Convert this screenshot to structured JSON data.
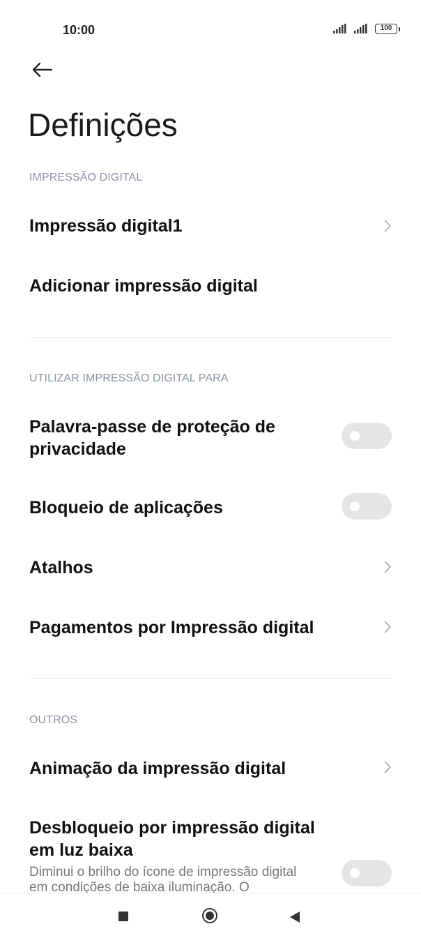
{
  "status": {
    "time": "10:00",
    "battery": "100"
  },
  "title": "Definições",
  "sections": {
    "fingerprint": "IMPRESSÃO DIGITAL",
    "use_for": "UTILIZAR IMPRESSÃO DIGITAL PARA",
    "others": "OUTROS"
  },
  "items": {
    "fingerprint1": "Impressão digital1",
    "add_fingerprint": "Adicionar impressão digital",
    "privacy_password": "Palavra-passe de proteção de privacidade",
    "app_lock": "Bloqueio de aplicações",
    "shortcuts": "Atalhos",
    "payments": "Pagamentos por Impressão digital",
    "animation": "Animação da impressão digital",
    "low_light_unlock": "Desbloqueio por impressão digital em luz baixa",
    "low_light_desc": "Diminui o brilho do ícone de impressão digital em condições de baixa iluminação. O"
  },
  "toggles": {
    "privacy_password": false,
    "app_lock": false,
    "low_light_unlock": false
  },
  "icons": [
    "back-arrow-icon",
    "chevron-right-icon",
    "signal-icon",
    "battery-icon",
    "nav-recents-icon",
    "nav-home-icon",
    "nav-back-icon"
  ],
  "colors": {
    "section_label": "#8a93a5",
    "toggle_off": "#e5e5e5"
  }
}
